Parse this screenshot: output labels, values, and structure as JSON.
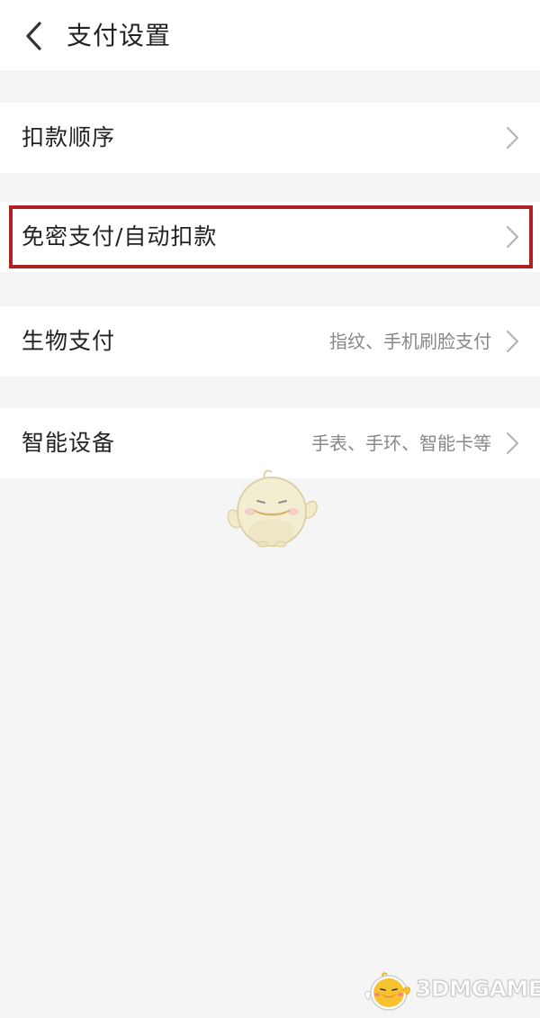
{
  "header": {
    "title": "支付设置",
    "back_icon": "chevron-left-icon"
  },
  "settings": [
    {
      "label": "扣款顺序",
      "value": "",
      "icon": "chevron-right-icon"
    },
    {
      "label": "免密支付/自动扣款",
      "value": "",
      "icon": "chevron-right-icon",
      "highlighted": true
    },
    {
      "label": "生物支付",
      "value": "指纹、手机刷脸支付",
      "icon": "chevron-right-icon"
    },
    {
      "label": "智能设备",
      "value": "手表、手环、智能卡等",
      "icon": "chevron-right-icon"
    }
  ],
  "watermark": {
    "text": "3DMGAME"
  },
  "colors": {
    "background": "#f5f5f5",
    "row_background": "#ffffff",
    "text_primary": "#222222",
    "text_secondary": "#888888",
    "chevron": "#b5b5b5",
    "highlight_border": "#b02126"
  }
}
